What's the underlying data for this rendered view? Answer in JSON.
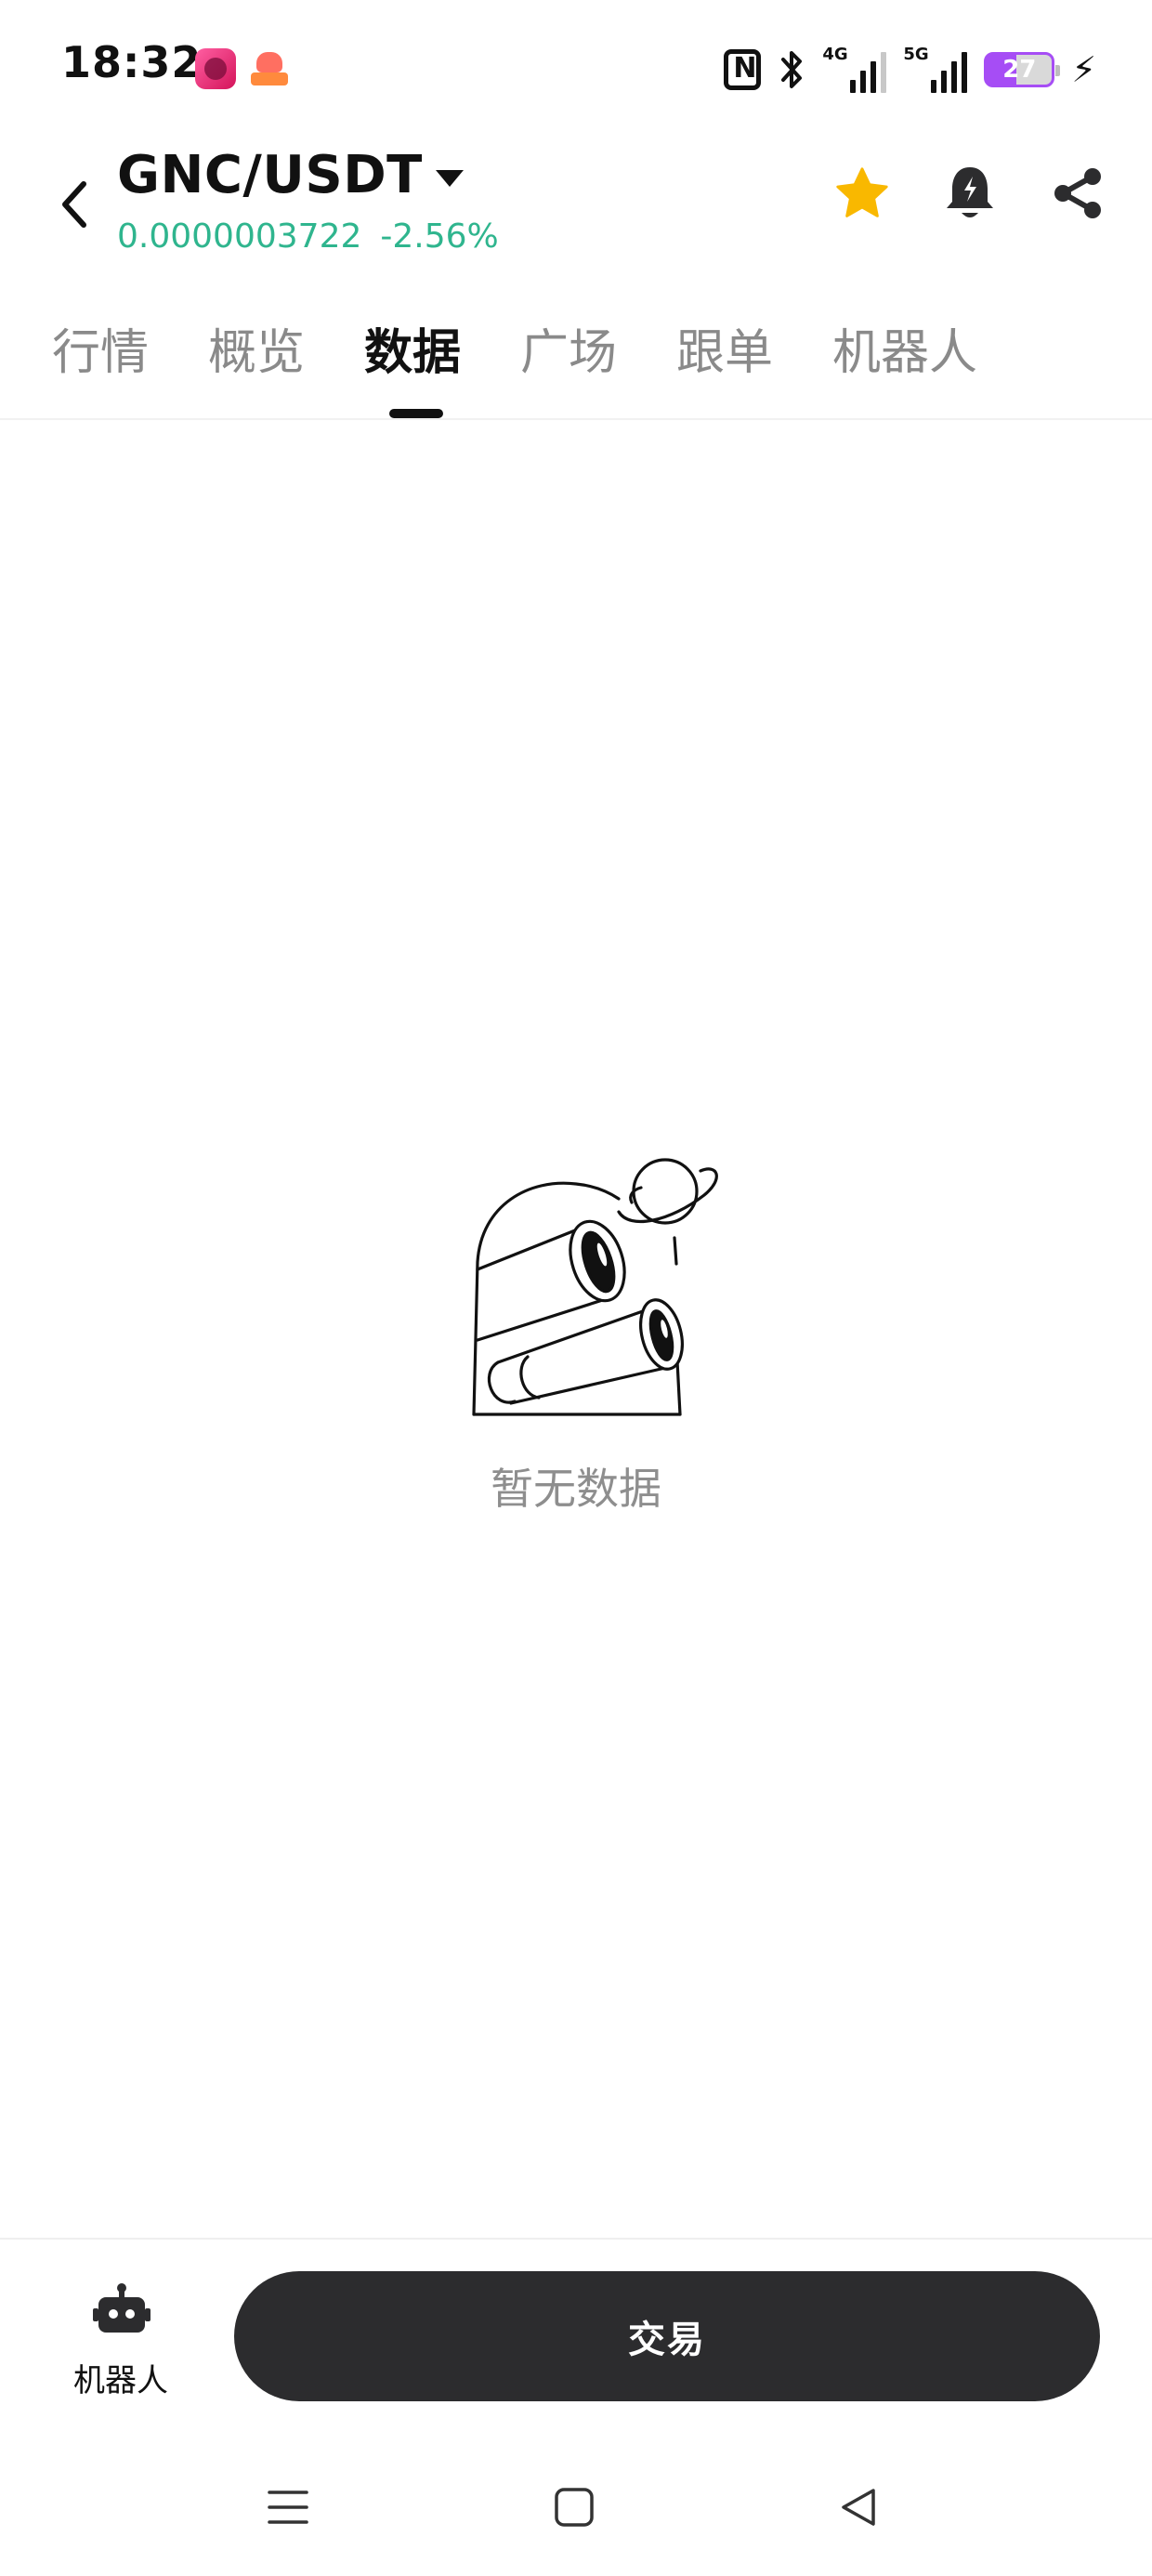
{
  "status_bar": {
    "time": "18:32",
    "signal_1_label": "4G",
    "signal_2_label": "5G",
    "battery_level": "27",
    "icons": [
      "app-icon-1",
      "app-icon-2",
      "nfc-icon",
      "bluetooth-icon",
      "signal-4g-icon",
      "signal-5g-icon",
      "battery-icon",
      "charging-icon"
    ]
  },
  "header": {
    "pair": "GNC/USDT",
    "price": "0.0000003722",
    "change": "-2.56%",
    "price_color": "#2fb58e",
    "actions": [
      "favorite-star-icon",
      "price-alert-bell-icon",
      "share-icon"
    ],
    "star_color": "#f9b800"
  },
  "tabs": [
    {
      "label": "行情",
      "active": false
    },
    {
      "label": "概览",
      "active": false
    },
    {
      "label": "数据",
      "active": true
    },
    {
      "label": "广场",
      "active": false
    },
    {
      "label": "跟单",
      "active": false
    },
    {
      "label": "机器人",
      "active": false
    }
  ],
  "empty_state": {
    "text": "暂无数据",
    "illustration": "binoculars-planet-illustration"
  },
  "bottom_bar": {
    "bot_label": "机器人",
    "trade_label": "交易"
  },
  "system_nav": {
    "buttons": [
      "menu-icon",
      "home-icon",
      "back-triangle-icon"
    ]
  }
}
